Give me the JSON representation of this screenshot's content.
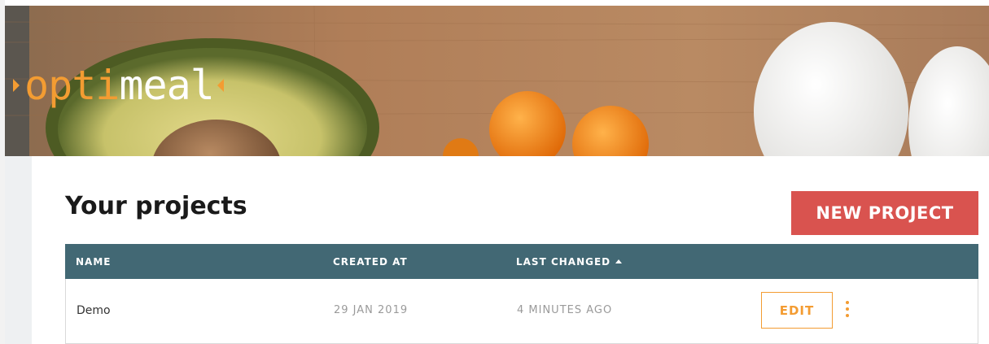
{
  "brand": {
    "logo_part1": "opti",
    "logo_part2": "meal",
    "accent_color": "#f39c32"
  },
  "page": {
    "title": "Your projects",
    "new_project_label": "NEW PROJECT"
  },
  "table": {
    "columns": [
      "NAME",
      "CREATED AT",
      "LAST CHANGED"
    ],
    "sort": {
      "column": "LAST CHANGED",
      "direction": "ascending",
      "icon": "sort-up-icon"
    },
    "rows": [
      {
        "name": "Demo",
        "created_at": "29 JAN 2019",
        "last_changed": "4 MINUTES AGO",
        "edit_label": "EDIT",
        "menu_icon": "more-vertical-icon"
      }
    ]
  },
  "colors": {
    "header_bg": "#426874",
    "primary_button": "#d9534f",
    "accent": "#f39c32"
  }
}
